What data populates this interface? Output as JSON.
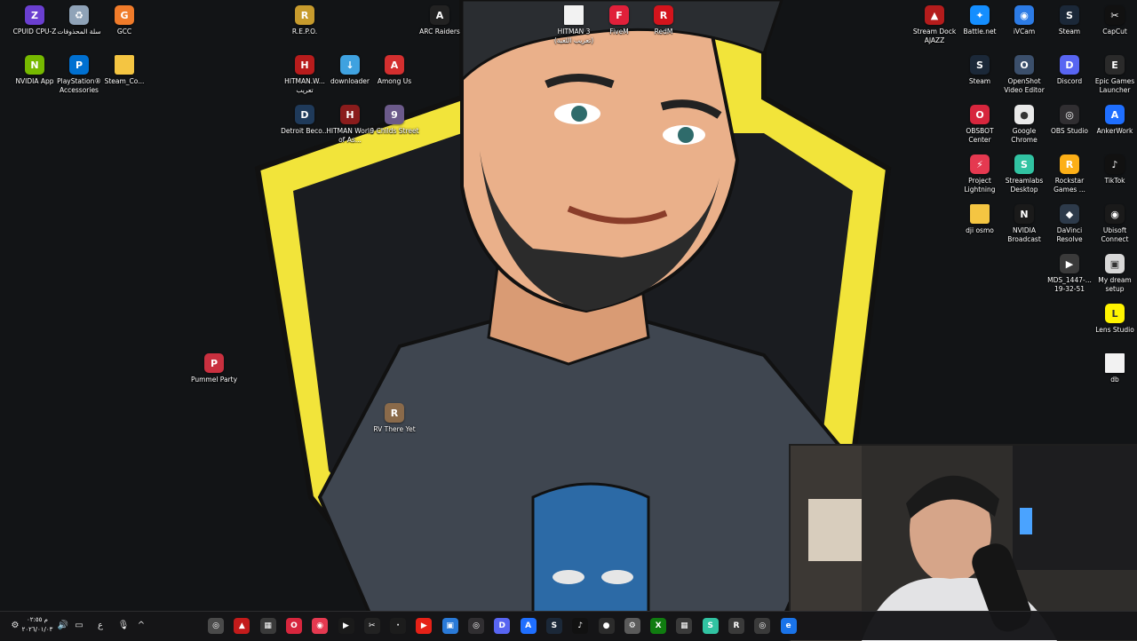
{
  "desktop_icons": [
    {
      "label": "CPUID CPU-Z",
      "icon": "cpu-z-icon",
      "bg": "#6a3fd0",
      "glyph": "Z"
    },
    {
      "label": "سلة المحذوفات",
      "icon": "recycle-bin-icon",
      "bg": "#8fa3b8",
      "glyph": "♻"
    },
    {
      "label": "GCC",
      "icon": "gcc-icon",
      "bg": "#f07b2a",
      "glyph": "G"
    },
    {
      "label": "R.E.P.O.",
      "icon": "repo-game-icon",
      "bg": "#c79b2d",
      "glyph": "R"
    },
    {
      "label": "ARC Raiders",
      "icon": "arc-raiders-icon",
      "bg": "#222",
      "glyph": "A"
    },
    {
      "label": "HITMAN 3 (تعريب اللعبة)",
      "icon": "file-icon",
      "bg": "#f2f2f2",
      "glyph": ""
    },
    {
      "label": "FiveM",
      "icon": "fivem-icon",
      "bg": "#e0203a",
      "glyph": "F"
    },
    {
      "label": "RedM",
      "icon": "redm-icon",
      "bg": "#d4141c",
      "glyph": "R"
    },
    {
      "label": "Stream Dock AJAZZ",
      "icon": "stream-dock-icon",
      "bg": "#b41c1c",
      "glyph": "▲"
    },
    {
      "label": "Battle.net",
      "icon": "battlenet-icon",
      "bg": "#148eff",
      "glyph": "✦"
    },
    {
      "label": "iVCam",
      "icon": "ivcam-icon",
      "bg": "#2c7be5",
      "glyph": "◉"
    },
    {
      "label": "Steam",
      "icon": "steam-icon",
      "bg": "#1b2838",
      "glyph": "S"
    },
    {
      "label": "CapCut",
      "icon": "capcut-icon",
      "bg": "#111",
      "glyph": "✂"
    },
    {
      "label": "NVIDIA App",
      "icon": "nvidia-app-icon",
      "bg": "#76b900",
      "glyph": "N"
    },
    {
      "label": "PlayStation® Accessories",
      "icon": "playstation-icon",
      "bg": "#0070d1",
      "glyph": "P"
    },
    {
      "label": "Steam_Co...",
      "icon": "folder-icon",
      "bg": "#f4c542",
      "glyph": ""
    },
    {
      "label": "HITMAN.W... تعريب",
      "icon": "hitman-translation-icon",
      "bg": "#b71c1c",
      "glyph": "H"
    },
    {
      "label": "downloader",
      "icon": "downloader-icon",
      "bg": "#3fa2e0",
      "glyph": "↓"
    },
    {
      "label": "Among Us",
      "icon": "among-us-icon",
      "bg": "#d32f2f",
      "glyph": "A"
    },
    {
      "label": "Steam",
      "icon": "steam-icon",
      "bg": "#1b2838",
      "glyph": "S"
    },
    {
      "label": "OpenShot Video Editor",
      "icon": "openshot-icon",
      "bg": "#3b4f6b",
      "glyph": "O"
    },
    {
      "label": "Discord",
      "icon": "discord-icon",
      "bg": "#5865f2",
      "glyph": "D"
    },
    {
      "label": "Epic Games Launcher",
      "icon": "epic-games-icon",
      "bg": "#2a2a2a",
      "glyph": "E"
    },
    {
      "label": "Detroit Beco...",
      "icon": "detroit-icon",
      "bg": "#1f3a5a",
      "glyph": "D"
    },
    {
      "label": "HITMAN World of As...",
      "icon": "hitman-woa-icon",
      "bg": "#8a1c1c",
      "glyph": "H"
    },
    {
      "label": "9 Childs Street",
      "icon": "nine-childs-street-icon",
      "bg": "#6b5a8a",
      "glyph": "9"
    },
    {
      "label": "OBSBOT Center",
      "icon": "obsbot-icon",
      "bg": "#d7263d",
      "glyph": "O"
    },
    {
      "label": "Google Chrome",
      "icon": "chrome-icon",
      "bg": "#e9e9e9",
      "glyph": "●"
    },
    {
      "label": "OBS Studio",
      "icon": "obs-studio-icon",
      "bg": "#302e31",
      "glyph": "◎"
    },
    {
      "label": "AnkerWork",
      "icon": "ankerwork-icon",
      "bg": "#1f6fff",
      "glyph": "A"
    },
    {
      "label": "Project Lightning",
      "icon": "project-lightning-icon",
      "bg": "#e53950",
      "glyph": "⚡"
    },
    {
      "label": "Streamlabs Desktop",
      "icon": "streamlabs-icon",
      "bg": "#31c3a2",
      "glyph": "S"
    },
    {
      "label": "Rockstar Games ...",
      "icon": "rockstar-icon",
      "bg": "#fcaf17",
      "glyph": "R"
    },
    {
      "label": "TikTok",
      "icon": "tiktok-icon",
      "bg": "#111",
      "glyph": "♪"
    },
    {
      "label": "dji osmo",
      "icon": "folder-icon",
      "bg": "#f4c542",
      "glyph": ""
    },
    {
      "label": "NVIDIA Broadcast",
      "icon": "nvidia-broadcast-icon",
      "bg": "#1a1a1a",
      "glyph": "N"
    },
    {
      "label": "DaVinci Resolve",
      "icon": "davinci-icon",
      "bg": "#2d3a4a",
      "glyph": "◆"
    },
    {
      "label": "Ubisoft Connect",
      "icon": "ubisoft-icon",
      "bg": "#1a1a1a",
      "glyph": "◉"
    },
    {
      "label": "Pummel Party",
      "icon": "pummel-party-icon",
      "bg": "#c9303f",
      "glyph": "P"
    },
    {
      "label": "MDS_1447-... 19-32-51",
      "icon": "video-file-icon",
      "bg": "#3a3a3a",
      "glyph": "▶"
    },
    {
      "label": "My dream setup",
      "icon": "image-file-icon",
      "bg": "#d8d8d8",
      "glyph": "▣"
    },
    {
      "label": "Lens Studio",
      "icon": "lens-studio-icon",
      "bg": "#fff400",
      "glyph": "L"
    },
    {
      "label": "RV There Yet",
      "icon": "rv-there-yet-icon",
      "bg": "#8a6a4a",
      "glyph": "R"
    },
    {
      "label": "db",
      "icon": "file-icon",
      "bg": "#f2f2f2",
      "glyph": ""
    }
  ],
  "taskbar": {
    "clock_time": "م ٠٢:٥٥",
    "clock_date": "٢٠٢٦/٠١/٠٣",
    "lang": "ع",
    "apps": [
      {
        "icon": "steam-overlay-icon",
        "bg": "#4a4a4a",
        "glyph": "◎"
      },
      {
        "icon": "arc-icon",
        "bg": "#c31b1b",
        "glyph": "▲"
      },
      {
        "icon": "app-icon",
        "bg": "#3a3a3a",
        "glyph": "▦"
      },
      {
        "icon": "obsbot-icon",
        "bg": "#d7263d",
        "glyph": "O"
      },
      {
        "icon": "project-lightning-icon",
        "bg": "#e53950",
        "glyph": "◉"
      },
      {
        "icon": "nvidia-broadcast-icon",
        "bg": "#1a1a1a",
        "glyph": "▶"
      },
      {
        "icon": "capcut-icon",
        "bg": "#222",
        "glyph": "✂"
      },
      {
        "icon": "idle-icon",
        "bg": "#1c1c1c",
        "glyph": "·"
      },
      {
        "icon": "youtube-icon",
        "bg": "#e62117",
        "glyph": "▶"
      },
      {
        "icon": "photos-icon",
        "bg": "#2a7ad8",
        "glyph": "▣"
      },
      {
        "icon": "obs-studio-icon",
        "bg": "#302e31",
        "glyph": "◎"
      },
      {
        "icon": "discord-icon",
        "bg": "#5865f2",
        "glyph": "D"
      },
      {
        "icon": "ankerwork-icon",
        "bg": "#1f6fff",
        "glyph": "A"
      },
      {
        "icon": "steam-icon",
        "bg": "#1b2838",
        "glyph": "S"
      },
      {
        "icon": "tiktok-icon",
        "bg": "#111",
        "glyph": "♪"
      },
      {
        "icon": "chrome-icon",
        "bg": "#2b2b2b",
        "glyph": "●"
      },
      {
        "icon": "settings-icon",
        "bg": "#5a5a5a",
        "glyph": "⚙"
      },
      {
        "icon": "xbox-icon",
        "bg": "#107c10",
        "glyph": "X"
      },
      {
        "icon": "calculator-icon",
        "bg": "#3a3a3a",
        "glyph": "▦"
      },
      {
        "icon": "streamlabs-icon",
        "bg": "#31c3a2",
        "glyph": "S"
      },
      {
        "icon": "redm-icon",
        "bg": "#3a3a3a",
        "glyph": "R"
      },
      {
        "icon": "obs-icon",
        "bg": "#3a3a3a",
        "glyph": "◎"
      },
      {
        "icon": "edge-icon",
        "bg": "#1a73e8",
        "glyph": "e"
      }
    ]
  }
}
